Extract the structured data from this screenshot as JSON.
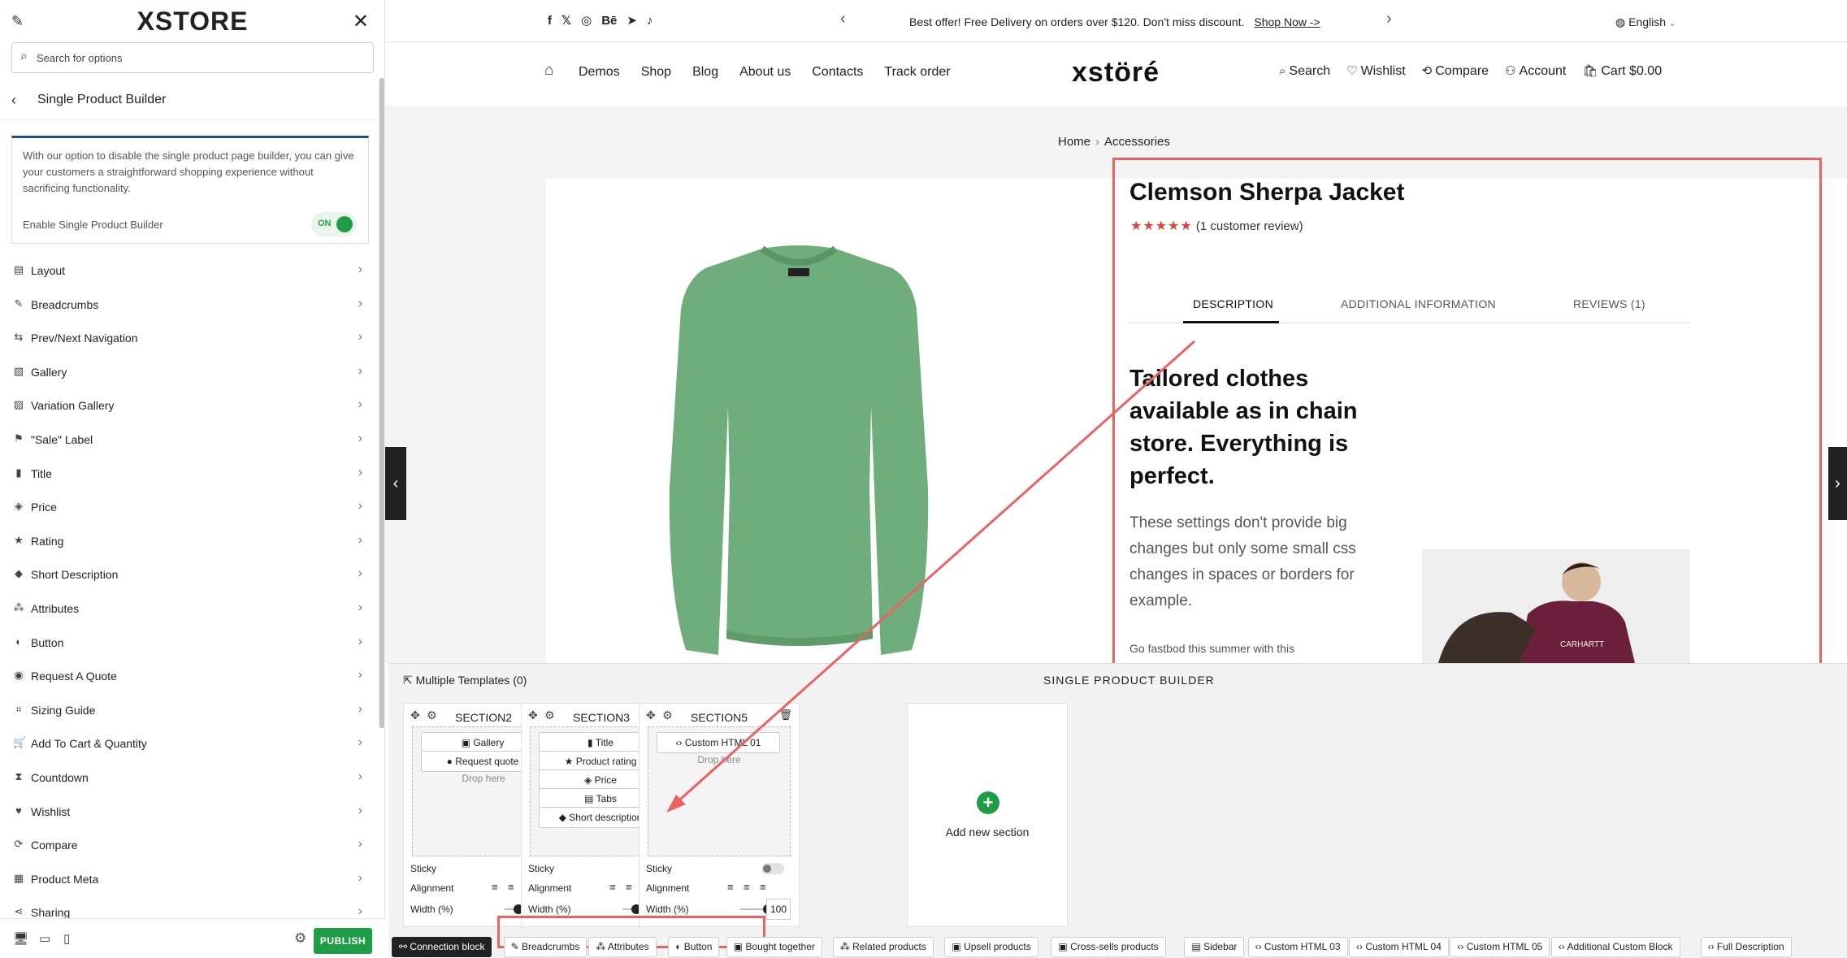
{
  "sidebar": {
    "logo": "XSTORE",
    "search_placeholder": "Search for options",
    "back_title": "Single Product Builder",
    "info_text": "With our option to disable the single product page builder, you can give your customers a straightforward shopping experience without sacrificing functionality.",
    "enable_label": "Enable Single Product Builder",
    "toggle_label": "ON",
    "items": [
      {
        "label": "Layout",
        "icon": "layout-icon"
      },
      {
        "label": "Breadcrumbs",
        "icon": "breadcrumbs-icon"
      },
      {
        "label": "Prev/Next Navigation",
        "icon": "navigation-icon"
      },
      {
        "label": "Gallery",
        "icon": "gallery-icon"
      },
      {
        "label": "Variation Gallery",
        "icon": "variation-gallery-icon"
      },
      {
        "label": "\"Sale\" Label",
        "icon": "sale-label-icon"
      },
      {
        "label": "Title",
        "icon": "title-icon"
      },
      {
        "label": "Price",
        "icon": "price-tag-icon"
      },
      {
        "label": "Rating",
        "icon": "star-icon"
      },
      {
        "label": "Short Description",
        "icon": "short-description-icon"
      },
      {
        "label": "Attributes",
        "icon": "attributes-icon"
      },
      {
        "label": "Button",
        "icon": "button-icon"
      },
      {
        "label": "Request A Quote",
        "icon": "quote-icon"
      },
      {
        "label": "Sizing Guide",
        "icon": "sizing-guide-icon"
      },
      {
        "label": "Add To Cart & Quantity",
        "icon": "cart-icon"
      },
      {
        "label": "Countdown",
        "icon": "hourglass-icon"
      },
      {
        "label": "Wishlist",
        "icon": "heart-icon"
      },
      {
        "label": "Compare",
        "icon": "compare-icon"
      },
      {
        "label": "Product Meta",
        "icon": "meta-icon"
      },
      {
        "label": "Sharing",
        "icon": "share-icon"
      }
    ],
    "publish_label": "PUBLISH"
  },
  "topbar": {
    "social_icons": [
      "f",
      "𝕏",
      "◎",
      "Bē",
      "➤",
      "♪"
    ],
    "promo_text": "Best offer! Free Delivery on orders over $120. Don't miss discount.",
    "promo_link": "Shop Now ->",
    "language": "English"
  },
  "header": {
    "nav": [
      "Demos",
      "Shop",
      "Blog",
      "About us",
      "Contacts",
      "Track order"
    ],
    "brand": "xstöré",
    "actions": [
      {
        "label": "Search",
        "icon": "search-icon",
        "glyph": "⌕"
      },
      {
        "label": "Wishlist",
        "icon": "heart-icon",
        "glyph": "♡"
      },
      {
        "label": "Compare",
        "icon": "compare-icon",
        "glyph": "⟲"
      },
      {
        "label": "Account",
        "icon": "user-icon",
        "glyph": "⚇"
      },
      {
        "label": "Cart $0.00",
        "icon": "cart-icon",
        "glyph": "🛍"
      }
    ]
  },
  "breadcrumb": {
    "home": "Home",
    "current": "Accessories"
  },
  "product": {
    "title": "Clemson Sherpa Jacket",
    "rating_stars": "★★★★★",
    "rating_text": "(1 customer review)",
    "tabs": [
      "DESCRIPTION",
      "ADDITIONAL INFORMATION",
      "REVIEWS (1)"
    ],
    "heading": "Tailored clothes available as in chain store. Everything is perfect.",
    "body": "These settings don't provide big changes but only some small css changes in spaces or borders for example.",
    "more": "Go fastbod this summer with this",
    "image_text": "CARHARTT"
  },
  "builder": {
    "multiple_templates": "Multiple Templates (0)",
    "title": "SINGLE PRODUCT BUILDER",
    "drop_hint": "Drop here",
    "sticky_label": "Sticky",
    "alignment_label": "Alignment",
    "width_label": "Width (%)",
    "toggle_off": "OFF",
    "sections": [
      {
        "name": "SECTION2",
        "blocks": [
          "Gallery",
          "Request quote"
        ],
        "width": "50"
      },
      {
        "name": "SECTION3",
        "blocks": [
          "Title",
          "Product rating",
          "Price",
          "Tabs",
          "Short description"
        ],
        "width": "50"
      },
      {
        "name": "SECTION5",
        "blocks": [
          "Custom HTML 01"
        ],
        "width": "100"
      }
    ],
    "add_section": "Add new section",
    "footer_blocks": [
      "Connection block",
      "Breadcrumbs",
      "Attributes",
      "Button",
      "Bought together",
      "Related products",
      "Upsell products",
      "Cross-sells products",
      "Sidebar",
      "Custom HTML 03",
      "Custom HTML 04",
      "Custom HTML 05",
      "Additional Custom Block",
      "Full Description"
    ]
  }
}
